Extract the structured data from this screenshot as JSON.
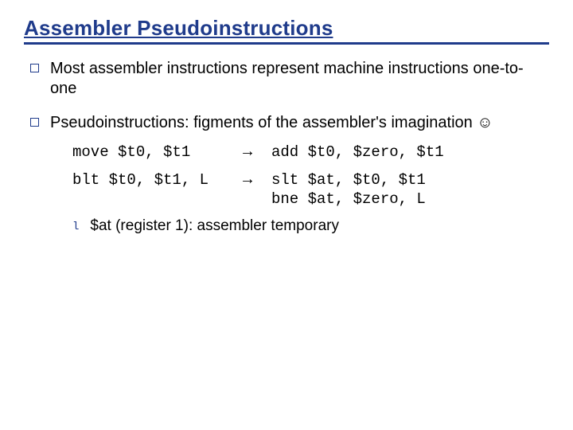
{
  "title": "Assembler Pseudoinstructions",
  "bullets": {
    "b1": "Most assembler instructions represent machine instructions one-to-one",
    "b2": "Pseudoinstructions: figments of the assembler's imagination ☺"
  },
  "code": {
    "row1_left": "move $t0, $t1",
    "row1_arrow": "→",
    "row1_right": "add $t0, $zero, $t1",
    "row2_left": "blt $t0, $t1, L",
    "row2_arrow": "→",
    "row2_right": "slt $at, $t0, $t1\nbne $at, $zero, L"
  },
  "sub": {
    "mark": "l",
    "text": "$at (register 1): assembler temporary"
  }
}
